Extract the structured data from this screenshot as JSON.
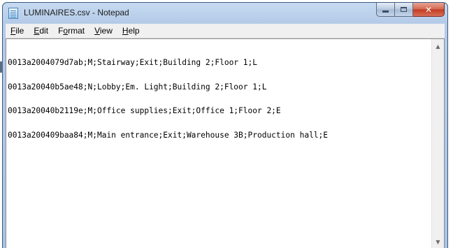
{
  "window": {
    "title": "LUMINAIRES.csv - Notepad",
    "icon": "notepad-icon",
    "buttons": {
      "minimize": "minimize-icon",
      "maximize": "maximize-icon",
      "close": "close-icon"
    }
  },
  "menubar": {
    "items": [
      {
        "accel": "F",
        "rest": "ile"
      },
      {
        "accel": "E",
        "rest": "dit"
      },
      {
        "pre": "F",
        "accel": "o",
        "rest": "rmat"
      },
      {
        "accel": "V",
        "rest": "iew"
      },
      {
        "accel": "H",
        "rest": "elp"
      }
    ]
  },
  "editor": {
    "lines": [
      "0013a2004079d7ab;M;Stairway;Exit;Building 2;Floor 1;L",
      "0013a20040b5ae48;N;Lobby;Em. Light;Building 2;Floor 1;L",
      "0013a20040b2119e;M;Office supplies;Exit;Office 1;Floor 2;E",
      "0013a200409baa84;M;Main entrance;Exit;Warehouse 3B;Production hall;E"
    ]
  },
  "colors": {
    "title_bar": "#b4cbe8",
    "close_button": "#c2391e",
    "editor_bg": "#ffffff"
  }
}
